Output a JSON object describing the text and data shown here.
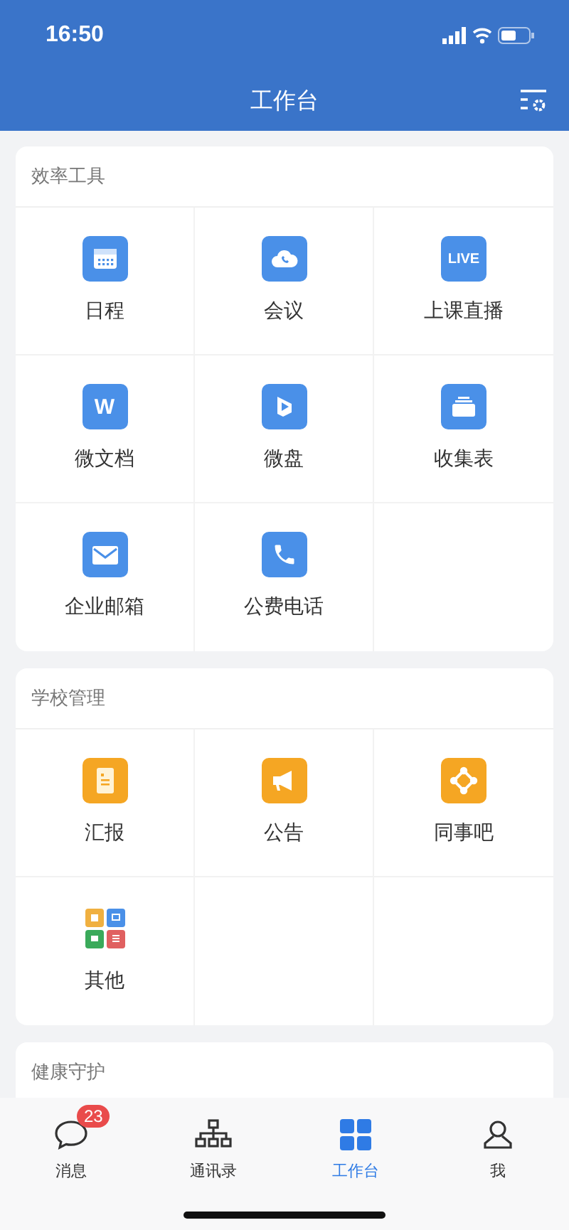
{
  "status_bar": {
    "time": "16:50"
  },
  "header": {
    "title": "工作台"
  },
  "sections": [
    {
      "title": "效率工具",
      "items": [
        {
          "label": "日程"
        },
        {
          "label": "会议"
        },
        {
          "label": "上课直播",
          "icon_text": "LIVE"
        },
        {
          "label": "微文档",
          "icon_text": "W"
        },
        {
          "label": "微盘"
        },
        {
          "label": "收集表"
        },
        {
          "label": "企业邮箱"
        },
        {
          "label": "公费电话"
        }
      ]
    },
    {
      "title": "学校管理",
      "items": [
        {
          "label": "汇报"
        },
        {
          "label": "公告"
        },
        {
          "label": "同事吧"
        },
        {
          "label": "其他"
        }
      ]
    },
    {
      "title": "健康守护"
    }
  ],
  "tabs": [
    {
      "label": "消息",
      "selected": false,
      "badge": "23"
    },
    {
      "label": "通讯录",
      "selected": false
    },
    {
      "label": "工作台",
      "selected": true
    },
    {
      "label": "我",
      "selected": false
    }
  ]
}
